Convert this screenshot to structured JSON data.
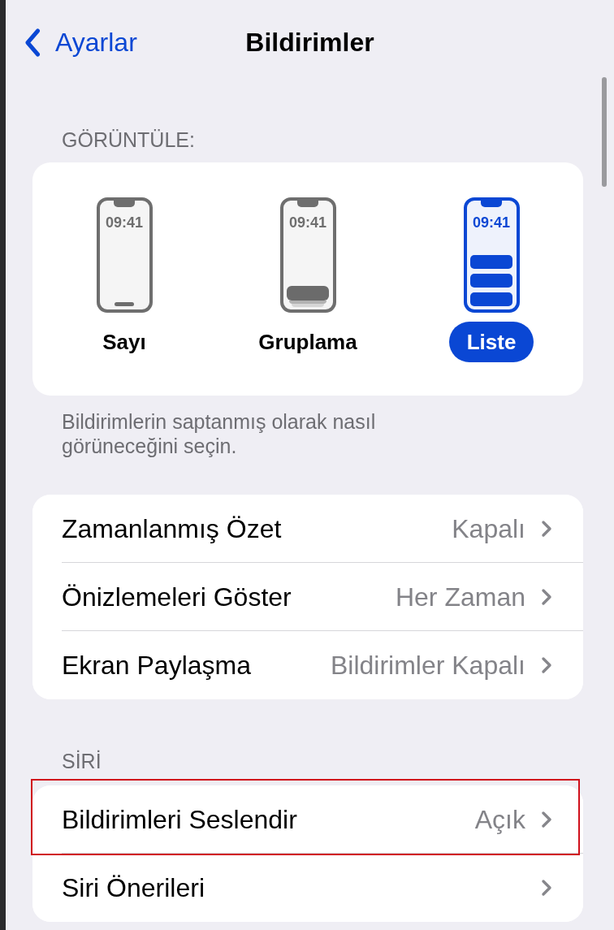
{
  "nav": {
    "back_label": "Ayarlar",
    "title": "Bildirimler"
  },
  "display": {
    "header": "GÖRÜNTÜLE:",
    "options": [
      {
        "kind": "count",
        "time": "09:41",
        "label": "Sayı",
        "selected": false
      },
      {
        "kind": "stack",
        "time": "09:41",
        "label": "Gruplama",
        "selected": false
      },
      {
        "kind": "list",
        "time": "09:41",
        "label": "Liste",
        "selected": true
      }
    ],
    "footer": "Bildirimlerin saptanmış olarak nasıl görüneceğini seçin."
  },
  "settings": {
    "rows": [
      {
        "label": "Zamanlanmış Özet",
        "value": "Kapalı"
      },
      {
        "label": "Önizlemeleri Göster",
        "value": "Her Zaman"
      },
      {
        "label": "Ekran Paylaşma",
        "value": "Bildirimler Kapalı"
      }
    ]
  },
  "siri": {
    "header": "SİRİ",
    "rows": [
      {
        "label": "Bildirimleri Seslendir",
        "value": "Açık",
        "highlighted": true
      },
      {
        "label": "Siri Önerileri",
        "highlighted": false
      }
    ]
  }
}
